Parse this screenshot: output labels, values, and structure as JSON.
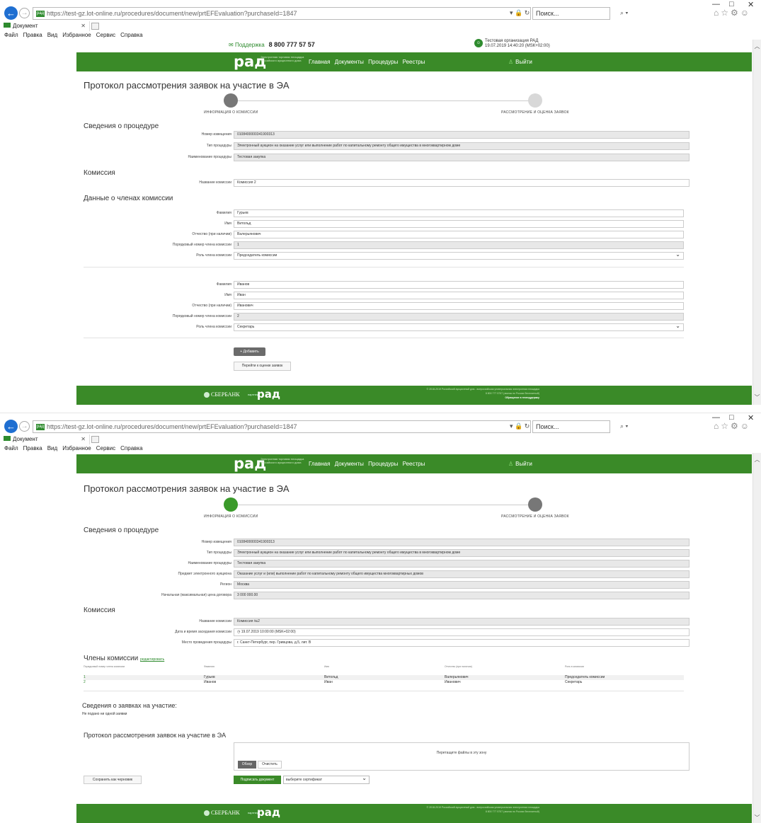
{
  "browser": {
    "url": "https://test-gz.lot-online.ru/procedures/document/new/prtEFEvaluation?purchaseId=1847",
    "search_placeholder": "Поиск...",
    "tab_title": "Документ",
    "menu": [
      "Файл",
      "Правка",
      "Вид",
      "Избранное",
      "Сервис",
      "Справка"
    ],
    "win_min": "—",
    "win_max": "□",
    "win_close": "✕"
  },
  "site": {
    "support_label": "Поддержка",
    "support_phone": "8 800 777 57 57",
    "org_name": "Тестовая организация РАД",
    "org_time": "19.07.2019 14:40:20 (МSК+02:00)",
    "logo": "рад",
    "logo_sub": "Электронная торговая площадка Российского аукционного дома",
    "nav": [
      "Главная",
      "Документы",
      "Процедуры",
      "Реестры"
    ],
    "logout": "Выйти",
    "footer_sber": "СБЕРБАНК",
    "footer_partner": "партнер",
    "footer_logo": "рад",
    "footer_copy": "© 2018-2019 Российский аукционный дом - всероссийская универсальная электронная площадка",
    "footer_phone": "8 800 777 5757 (звонок по России бесплатный)",
    "footer_link": "Обращение в техподдержку"
  },
  "page": {
    "title": "Протокол рассмотрения заявок на участие в ЭА",
    "step1": "Информация о комиссии",
    "step2": "Рассмотрение и оценка заявок"
  },
  "shot1": {
    "procedure_title": "Сведения о процедуре",
    "notice_label": "Номер извещения",
    "notice_value": "0108400000341900313",
    "type_label": "Тип процедуры",
    "type_value": "Электронный аукцион на оказание услуг или выполнение работ по капитальному ремонту общего имущества в многоквартирном доме",
    "name_label": "Наименование процедуры",
    "name_value": "Тестовая закупка",
    "commission_title": "Комиссия",
    "commission_label": "Название комиссии",
    "commission_value": "Комиссия 2",
    "members_title": "Данные о членах комиссии",
    "labels": {
      "last": "Фамилия",
      "first": "Имя",
      "middle": "Отчество (при наличии)",
      "order": "Порядковый номер члена комиссии",
      "role": "Роль члена комиссии"
    },
    "members": [
      {
        "last": "Гурьев",
        "first": "Витольд",
        "middle": "Валерьянович",
        "order": "1",
        "role": "Председатель комиссии"
      },
      {
        "last": "Иванов",
        "first": "Иван",
        "middle": "Иванович",
        "order": "2",
        "role": "Секретарь"
      }
    ],
    "add_button": "+ Добавить",
    "next_button": "Перейти к оценке заявок"
  },
  "shot2": {
    "procedure_title": "Сведения о процедуре",
    "fields": [
      {
        "label": "Номер извещения",
        "value": "0108400000341900313"
      },
      {
        "label": "Тип процедуры",
        "value": "Электронный аукцион на оказание услуг или выполнение работ по капитальному ремонту общего имущества в многоквартирном доме"
      },
      {
        "label": "Наименование процедуры",
        "value": "Тестовая закупка"
      },
      {
        "label": "Предмет электронного аукциона",
        "value": "Оказание услуг и (или) выполнение работ по капитальному ремонту общего имущества многоквартирных домов"
      },
      {
        "label": "Регион",
        "value": "Москва"
      },
      {
        "label": "Начальная (максимальная) цена договора",
        "value": "3 000 000.00"
      }
    ],
    "commission_title": "Комиссия",
    "commission_name_label": "Название комиссии",
    "commission_name_value": "Комиссия №2",
    "meeting_label": "Дата и время заседания комиссии",
    "meeting_value": "19.07.2019 10:00:00 (MSK+02:00)",
    "place_label": "Место проведения процедуры",
    "place_value": "г. Санкт-Петербург, пер. Гривцова, д.5, лит. В",
    "members_title": "Члены комиссии",
    "edit_link": "редактировать",
    "table_headers": [
      "Порядковый номер члена комиссии",
      "Фамилия",
      "Имя",
      "Отчество (при наличии)",
      "Роль в комиссии"
    ],
    "table_rows": [
      [
        "1",
        "Гурьев",
        "Витольд",
        "Валерьянович",
        "Председатель комиссии"
      ],
      [
        "2",
        "Иванов",
        "Иван",
        "Иванович",
        "Секретарь"
      ]
    ],
    "applications_title": "Сведения о заявках на участие:",
    "applications_empty": "Не подано ни одной заявки",
    "protocol_title": "Протокол рассмотрения заявок на участие в ЭА",
    "drop_hint": "Перетащите файлы в эту зону",
    "browse_button": "Обзор",
    "clear_button": "Очистить",
    "draft_button": "Сохранить как черновик",
    "sign_button": "Подписать документ",
    "cert_select": "выберите сертификат"
  },
  "colors": {
    "brand_green": "#3a8a28",
    "step_active": "#3a9a2a",
    "step_inactive": "#d8d8d8",
    "step_inactive2": "#777777"
  }
}
